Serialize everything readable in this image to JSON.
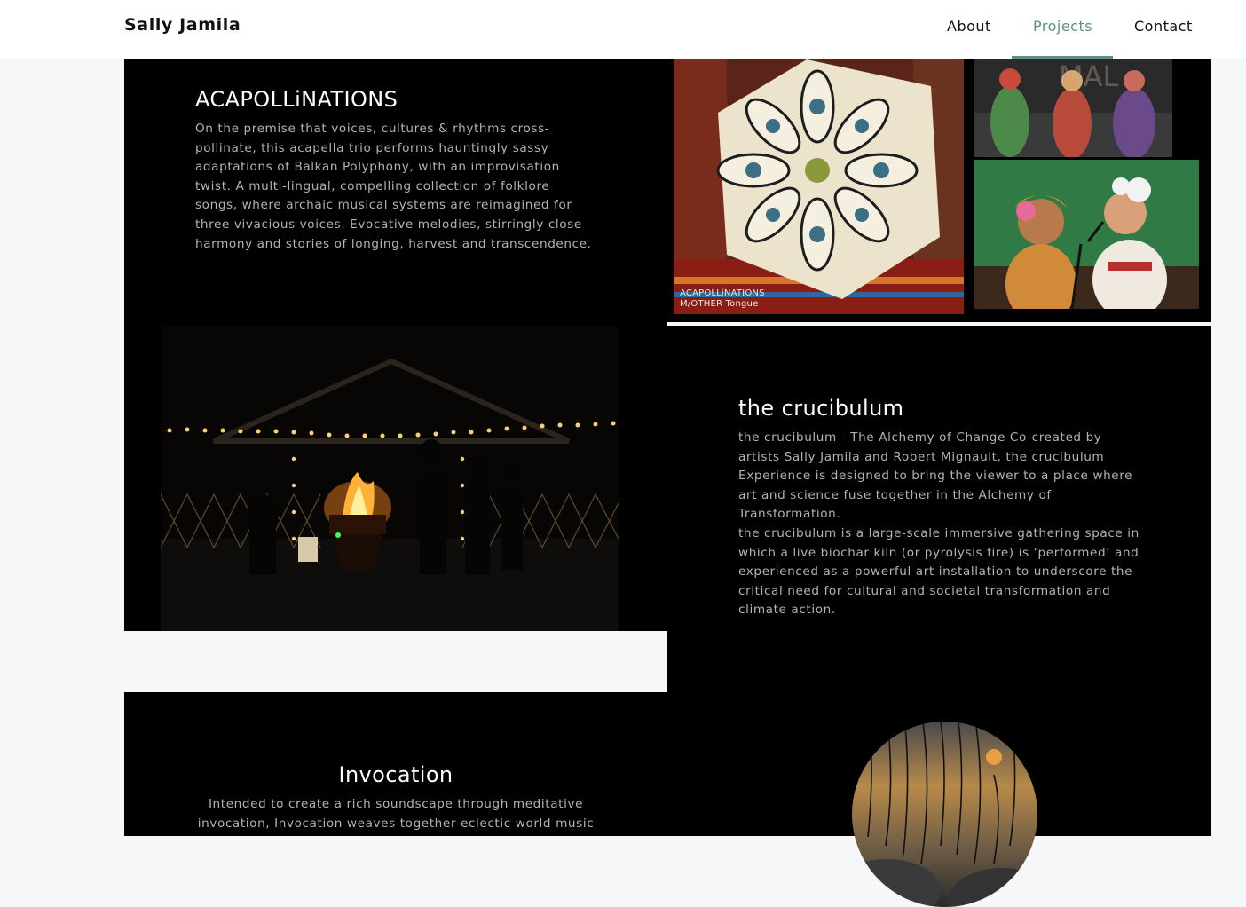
{
  "header": {
    "brand": "Sally Jamila",
    "nav": [
      {
        "label": "About"
      },
      {
        "label": "Projects",
        "active": true
      },
      {
        "label": "Contact"
      }
    ],
    "accent_color": "#5f9088"
  },
  "projects": [
    {
      "title": "ACAPOLLiNATIONS",
      "description": "On the premise that voices, cultures & rhythms cross-pollinate, this acapella trio performs hauntingly sassy adaptations of Balkan Polyphony, with an improvisation twist. A multi-lingual, compelling collection of folklore songs, where archaic musical systems are reimagined for three vivacious voices. Evocative melodies, stirringly close harmony and stories of longing, harvest and transcendence.",
      "image_caption_line1": "ACAPOLLiNATIONS",
      "image_caption_line2": "M/OTHER Tongue"
    },
    {
      "title": "the crucibulum",
      "description_p1": "the crucibulum - The Alchemy of Change Co-created by artists Sally Jamila and Robert Mignault, the crucibulum Experience is designed to bring the viewer to a place where art and science fuse together in the Alchemy of Transformation.",
      "description_p2": "the crucibulum is a large-scale immersive gathering space in which a live biochar kiln (or pyrolysis fire) is ‘performed’ and experienced as a powerful art installation to underscore the critical need for cultural and societal transformation and climate action."
    },
    {
      "title": "Invocation",
      "description": "Intended to create a rich soundscape through meditative invocation, Invocation weaves together eclectic world music"
    }
  ]
}
